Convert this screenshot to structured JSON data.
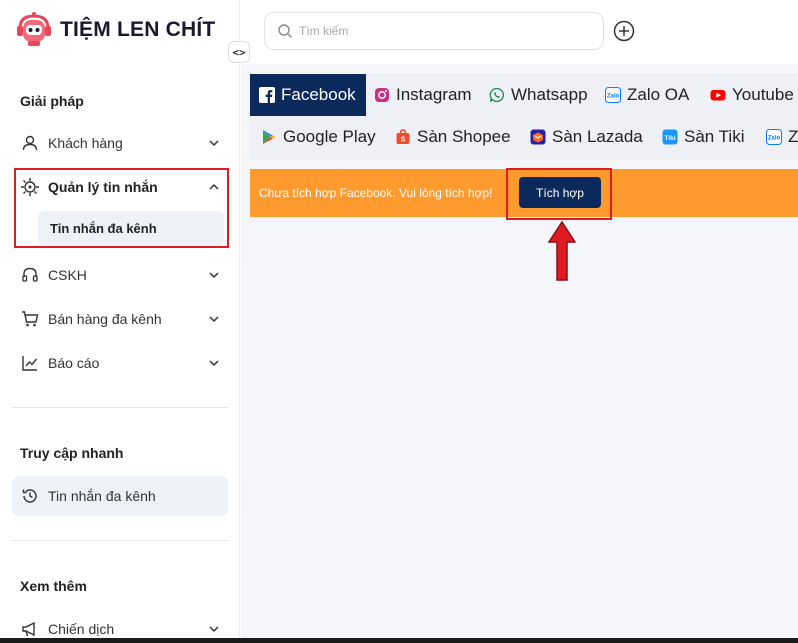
{
  "brand": {
    "name": "TIỆM LEN CHÍT",
    "logo_icon": "robot-headset-logo"
  },
  "sidebar": {
    "collapse_label": "<>",
    "sections": {
      "solutions_title": "Giải pháp",
      "quick_title": "Truy cập nhanh",
      "more_title": "Xem thêm"
    },
    "items": [
      {
        "label": "Khách hàng",
        "icon": "user-icon"
      },
      {
        "label": "Quản lý tin nhắn",
        "icon": "message-hub-icon",
        "expanded": true
      },
      {
        "label": "CSKH",
        "icon": "headset-icon"
      },
      {
        "label": "Bán hàng đa kênh",
        "icon": "cart-icon"
      },
      {
        "label": "Báo cáo",
        "icon": "chart-icon"
      }
    ],
    "sub_item": {
      "label": "Tin nhắn đa kênh"
    },
    "quick_item": {
      "label": "Tin nhắn đa kênh",
      "icon": "history-icon"
    },
    "more_item": {
      "label": "Chiến dịch",
      "icon": "megaphone-icon"
    }
  },
  "header": {
    "search_placeholder": "Tìm kiếm"
  },
  "tabs": [
    {
      "label": "Facebook",
      "active": true
    },
    {
      "label": "Instagram"
    },
    {
      "label": "Whatsapp"
    },
    {
      "label": "Zalo OA"
    },
    {
      "label": "Youtube"
    },
    {
      "label": "Google Play"
    },
    {
      "label": "Sàn Shopee"
    },
    {
      "label": "Sàn Lazada"
    },
    {
      "label": "Sàn Tiki"
    },
    {
      "label": "Z"
    }
  ],
  "banner": {
    "message": "Chưa tích hợp Facebook. Vui lòng tích hợp!",
    "button_label": "Tích hợp"
  },
  "colors": {
    "accent_navy": "#0b2a5b",
    "banner_orange": "#ff9a2e",
    "highlight_red": "#e01b24"
  }
}
